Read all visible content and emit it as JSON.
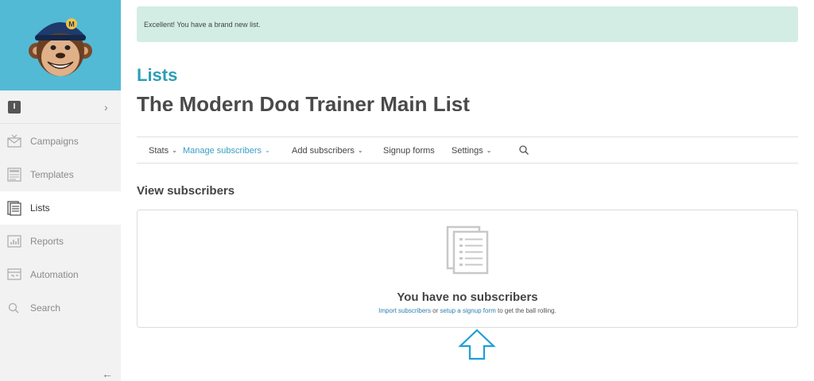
{
  "sidebar": {
    "account_badge": "I",
    "account_chevron": "›",
    "items": [
      {
        "label": "Campaigns",
        "icon": "envelope-icon",
        "active": false
      },
      {
        "label": "Templates",
        "icon": "template-icon",
        "active": false
      },
      {
        "label": "Lists",
        "icon": "list-icon",
        "active": true
      },
      {
        "label": "Reports",
        "icon": "bar-chart-icon",
        "active": false
      },
      {
        "label": "Automation",
        "icon": "automation-icon",
        "active": false
      },
      {
        "label": "Search",
        "icon": "search-icon",
        "active": false
      }
    ],
    "collapse_arrow": "←"
  },
  "alert": {
    "text": "Excellent! You have a brand new list."
  },
  "header": {
    "title": "Lists",
    "list_name": "The Modern Dog Trainer Main List"
  },
  "tabs": [
    {
      "label": "Stats",
      "has_caret": true,
      "active": false
    },
    {
      "label": "Manage subscribers",
      "has_caret": true,
      "active": true
    },
    {
      "label": "Add subscribers",
      "has_caret": true,
      "active": false
    },
    {
      "label": "Signup forms",
      "has_caret": false,
      "active": false
    },
    {
      "label": "Settings",
      "has_caret": true,
      "active": false
    }
  ],
  "caret": "⌄",
  "section": {
    "title": "View subscribers"
  },
  "empty_state": {
    "title": "You have no subscribers",
    "link_import": "Import subscribers",
    "text_or": " or ",
    "link_signup": "setup a signup form",
    "text_tail": " to get the ball rolling."
  },
  "colors": {
    "brand_blue": "#52bad5",
    "title_teal": "#2b9fb6",
    "link_blue": "#2b7fb0",
    "active_tab": "#3a9ec4",
    "alert_bg": "#d3ede4",
    "annotation_arrow": "#1e9fd8"
  }
}
